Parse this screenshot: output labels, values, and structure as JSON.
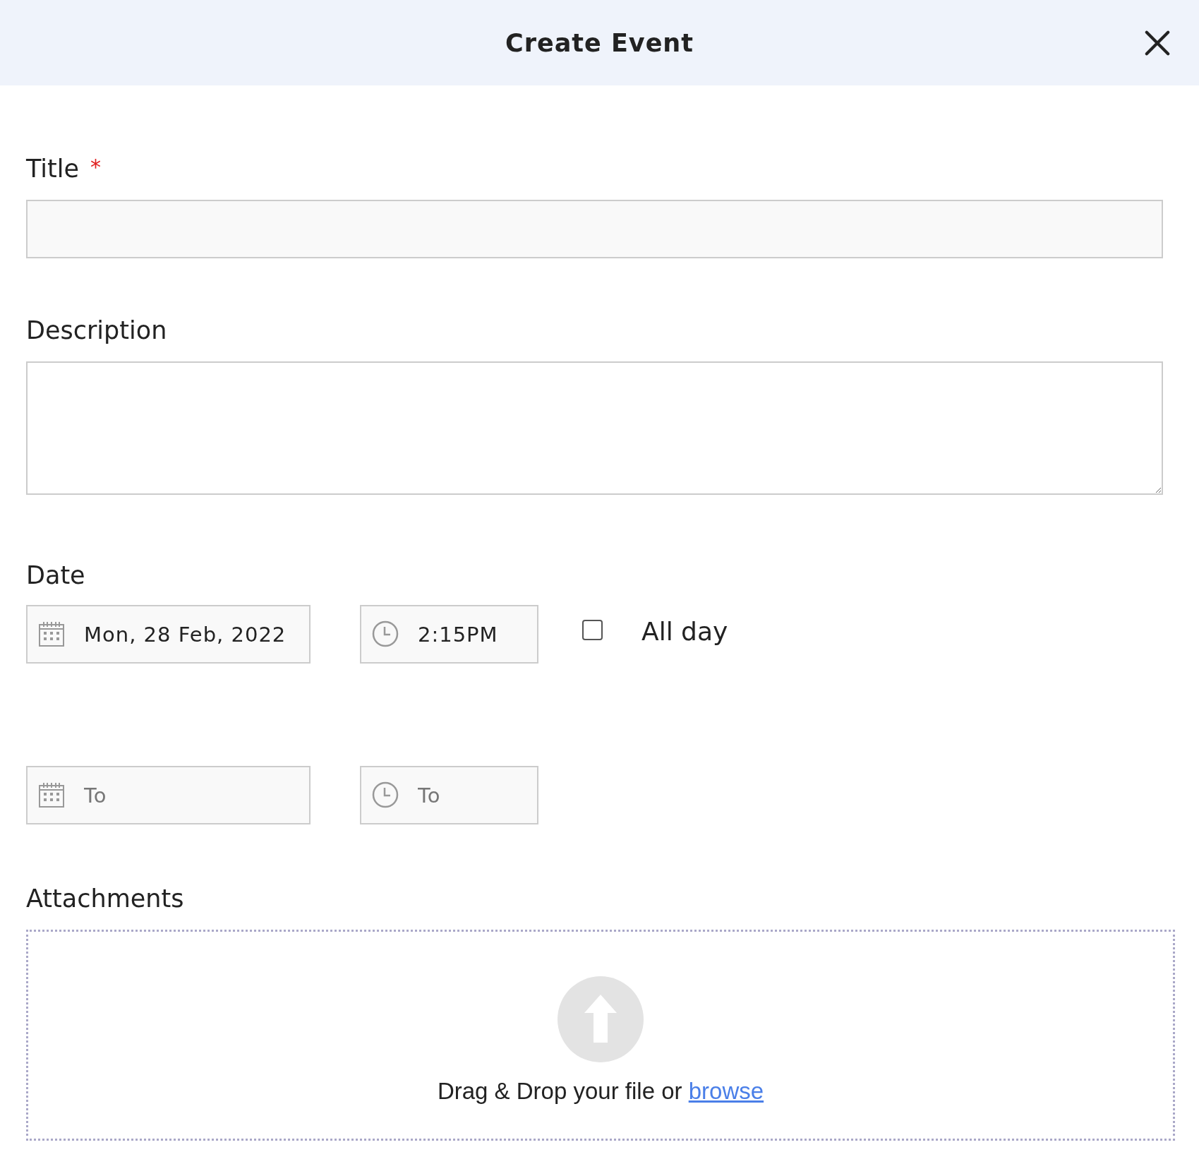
{
  "dialog": {
    "title": "Create Event"
  },
  "title_field": {
    "label": "Title",
    "required_mark": "*"
  },
  "description_field": {
    "label": "Description"
  },
  "date": {
    "label": "Date",
    "start_date": {
      "value": "Mon, 28 Feb, 2022"
    },
    "start_time": {
      "value": "2:15PM"
    },
    "all_day": {
      "label": "All day",
      "checked": false
    },
    "end_date": {
      "placeholder": "To"
    },
    "end_time": {
      "placeholder": "To"
    }
  },
  "attachments": {
    "label": "Attachments",
    "drop_text": "Drag & Drop your file or",
    "browse_link": "browse"
  }
}
